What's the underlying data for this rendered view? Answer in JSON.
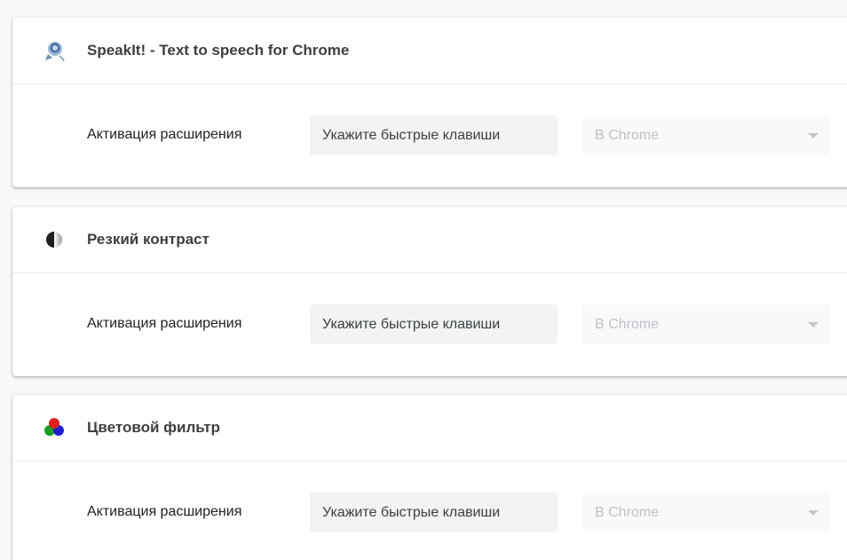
{
  "extensions": [
    {
      "name": "SpeakIt! - Text to speech for Chrome",
      "icon": "speakit-icon",
      "shortcut_label": "Активация расширения",
      "shortcut_placeholder": "Укажите быстрые клавиши",
      "scope_value": "В Chrome"
    },
    {
      "name": "Резкий контраст",
      "icon": "high-contrast-icon",
      "shortcut_label": "Активация расширения",
      "shortcut_placeholder": "Укажите быстрые клавиши",
      "scope_value": "В Chrome"
    },
    {
      "name": "Цветовой фильтр",
      "icon": "color-filter-icon",
      "shortcut_label": "Активация расширения",
      "shortcut_placeholder": "Укажите быстрые клавиши",
      "scope_value": "В Chrome"
    }
  ],
  "colors": {
    "page_background": "#f8f9fa",
    "card_background": "#ffffff",
    "input_background": "#f1f3f4",
    "disabled_text": "#bdc1c6"
  }
}
